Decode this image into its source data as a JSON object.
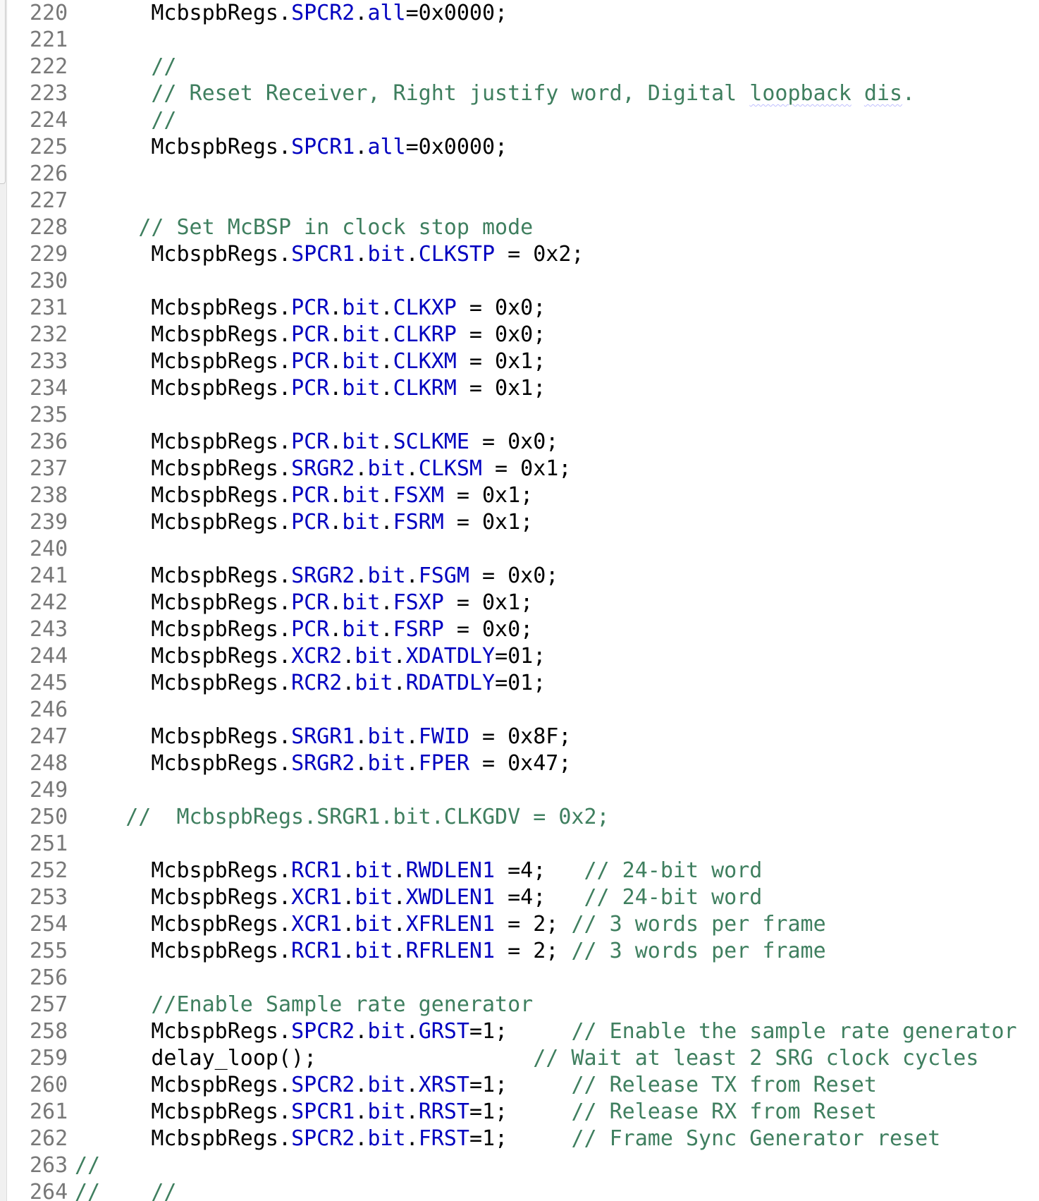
{
  "editor": {
    "lines": [
      {
        "num": "220",
        "tokens": [
          {
            "t": "      "
          },
          {
            "t": "McbspbRegs."
          },
          {
            "t": "SPCR2",
            "c": "field"
          },
          {
            "t": "."
          },
          {
            "t": "all",
            "c": "field"
          },
          {
            "t": "=0x0000;"
          }
        ]
      },
      {
        "num": "221",
        "tokens": []
      },
      {
        "num": "222",
        "tokens": [
          {
            "t": "      "
          },
          {
            "t": "//",
            "c": "comment"
          }
        ]
      },
      {
        "num": "223",
        "tokens": [
          {
            "t": "      "
          },
          {
            "t": "// Reset Receiver, Right justify word, Digital ",
            "c": "comment"
          },
          {
            "t": "loopback",
            "c": "spell"
          },
          {
            "t": " ",
            "c": "comment"
          },
          {
            "t": "dis",
            "c": "spell"
          },
          {
            "t": ".",
            "c": "comment"
          }
        ]
      },
      {
        "num": "224",
        "tokens": [
          {
            "t": "      "
          },
          {
            "t": "//",
            "c": "comment"
          }
        ]
      },
      {
        "num": "225",
        "tokens": [
          {
            "t": "      "
          },
          {
            "t": "McbspbRegs."
          },
          {
            "t": "SPCR1",
            "c": "field"
          },
          {
            "t": "."
          },
          {
            "t": "all",
            "c": "field"
          },
          {
            "t": "=0x0000;"
          }
        ]
      },
      {
        "num": "226",
        "tokens": []
      },
      {
        "num": "227",
        "tokens": []
      },
      {
        "num": "228",
        "tokens": [
          {
            "t": "     "
          },
          {
            "t": "// Set McBSP in clock stop mode",
            "c": "comment"
          }
        ]
      },
      {
        "num": "229",
        "tokens": [
          {
            "t": "      "
          },
          {
            "t": "McbspbRegs."
          },
          {
            "t": "SPCR1",
            "c": "field"
          },
          {
            "t": "."
          },
          {
            "t": "bit",
            "c": "field"
          },
          {
            "t": "."
          },
          {
            "t": "CLKSTP",
            "c": "field"
          },
          {
            "t": " = 0x2;"
          }
        ]
      },
      {
        "num": "230",
        "tokens": []
      },
      {
        "num": "231",
        "tokens": [
          {
            "t": "      "
          },
          {
            "t": "McbspbRegs."
          },
          {
            "t": "PCR",
            "c": "field"
          },
          {
            "t": "."
          },
          {
            "t": "bit",
            "c": "field"
          },
          {
            "t": "."
          },
          {
            "t": "CLKXP",
            "c": "field"
          },
          {
            "t": " = 0x0;"
          }
        ]
      },
      {
        "num": "232",
        "tokens": [
          {
            "t": "      "
          },
          {
            "t": "McbspbRegs."
          },
          {
            "t": "PCR",
            "c": "field"
          },
          {
            "t": "."
          },
          {
            "t": "bit",
            "c": "field"
          },
          {
            "t": "."
          },
          {
            "t": "CLKRP",
            "c": "field"
          },
          {
            "t": " = 0x0;"
          }
        ]
      },
      {
        "num": "233",
        "tokens": [
          {
            "t": "      "
          },
          {
            "t": "McbspbRegs."
          },
          {
            "t": "PCR",
            "c": "field"
          },
          {
            "t": "."
          },
          {
            "t": "bit",
            "c": "field"
          },
          {
            "t": "."
          },
          {
            "t": "CLKXM",
            "c": "field"
          },
          {
            "t": " = 0x1;"
          }
        ]
      },
      {
        "num": "234",
        "tokens": [
          {
            "t": "      "
          },
          {
            "t": "McbspbRegs."
          },
          {
            "t": "PCR",
            "c": "field"
          },
          {
            "t": "."
          },
          {
            "t": "bit",
            "c": "field"
          },
          {
            "t": "."
          },
          {
            "t": "CLKRM",
            "c": "field"
          },
          {
            "t": " = 0x1;"
          }
        ]
      },
      {
        "num": "235",
        "tokens": []
      },
      {
        "num": "236",
        "tokens": [
          {
            "t": "      "
          },
          {
            "t": "McbspbRegs."
          },
          {
            "t": "PCR",
            "c": "field"
          },
          {
            "t": "."
          },
          {
            "t": "bit",
            "c": "field"
          },
          {
            "t": "."
          },
          {
            "t": "SCLKME",
            "c": "field"
          },
          {
            "t": " = 0x0;"
          }
        ]
      },
      {
        "num": "237",
        "tokens": [
          {
            "t": "      "
          },
          {
            "t": "McbspbRegs."
          },
          {
            "t": "SRGR2",
            "c": "field"
          },
          {
            "t": "."
          },
          {
            "t": "bit",
            "c": "field"
          },
          {
            "t": "."
          },
          {
            "t": "CLKSM",
            "c": "field"
          },
          {
            "t": " = 0x1;"
          }
        ]
      },
      {
        "num": "238",
        "tokens": [
          {
            "t": "      "
          },
          {
            "t": "McbspbRegs."
          },
          {
            "t": "PCR",
            "c": "field"
          },
          {
            "t": "."
          },
          {
            "t": "bit",
            "c": "field"
          },
          {
            "t": "."
          },
          {
            "t": "FSXM",
            "c": "field"
          },
          {
            "t": " = 0x1;"
          }
        ]
      },
      {
        "num": "239",
        "tokens": [
          {
            "t": "      "
          },
          {
            "t": "McbspbRegs."
          },
          {
            "t": "PCR",
            "c": "field"
          },
          {
            "t": "."
          },
          {
            "t": "bit",
            "c": "field"
          },
          {
            "t": "."
          },
          {
            "t": "FSRM",
            "c": "field"
          },
          {
            "t": " = 0x1;"
          }
        ]
      },
      {
        "num": "240",
        "tokens": []
      },
      {
        "num": "241",
        "tokens": [
          {
            "t": "      "
          },
          {
            "t": "McbspbRegs."
          },
          {
            "t": "SRGR2",
            "c": "field"
          },
          {
            "t": "."
          },
          {
            "t": "bit",
            "c": "field"
          },
          {
            "t": "."
          },
          {
            "t": "FSGM",
            "c": "field"
          },
          {
            "t": " = 0x0;"
          }
        ]
      },
      {
        "num": "242",
        "tokens": [
          {
            "t": "      "
          },
          {
            "t": "McbspbRegs."
          },
          {
            "t": "PCR",
            "c": "field"
          },
          {
            "t": "."
          },
          {
            "t": "bit",
            "c": "field"
          },
          {
            "t": "."
          },
          {
            "t": "FSXP",
            "c": "field"
          },
          {
            "t": " = 0x1;"
          }
        ]
      },
      {
        "num": "243",
        "tokens": [
          {
            "t": "      "
          },
          {
            "t": "McbspbRegs."
          },
          {
            "t": "PCR",
            "c": "field"
          },
          {
            "t": "."
          },
          {
            "t": "bit",
            "c": "field"
          },
          {
            "t": "."
          },
          {
            "t": "FSRP",
            "c": "field"
          },
          {
            "t": " = 0x0;"
          }
        ]
      },
      {
        "num": "244",
        "tokens": [
          {
            "t": "      "
          },
          {
            "t": "McbspbRegs."
          },
          {
            "t": "XCR2",
            "c": "field"
          },
          {
            "t": "."
          },
          {
            "t": "bit",
            "c": "field"
          },
          {
            "t": "."
          },
          {
            "t": "XDATDLY",
            "c": "field"
          },
          {
            "t": "=01;"
          }
        ]
      },
      {
        "num": "245",
        "tokens": [
          {
            "t": "      "
          },
          {
            "t": "McbspbRegs."
          },
          {
            "t": "RCR2",
            "c": "field"
          },
          {
            "t": "."
          },
          {
            "t": "bit",
            "c": "field"
          },
          {
            "t": "."
          },
          {
            "t": "RDATDLY",
            "c": "field"
          },
          {
            "t": "=01;"
          }
        ]
      },
      {
        "num": "246",
        "tokens": []
      },
      {
        "num": "247",
        "tokens": [
          {
            "t": "      "
          },
          {
            "t": "McbspbRegs."
          },
          {
            "t": "SRGR1",
            "c": "field"
          },
          {
            "t": "."
          },
          {
            "t": "bit",
            "c": "field"
          },
          {
            "t": "."
          },
          {
            "t": "FWID",
            "c": "field"
          },
          {
            "t": " = 0x8F;"
          }
        ]
      },
      {
        "num": "248",
        "tokens": [
          {
            "t": "      "
          },
          {
            "t": "McbspbRegs."
          },
          {
            "t": "SRGR2",
            "c": "field"
          },
          {
            "t": "."
          },
          {
            "t": "bit",
            "c": "field"
          },
          {
            "t": "."
          },
          {
            "t": "FPER",
            "c": "field"
          },
          {
            "t": " = 0x47;"
          }
        ]
      },
      {
        "num": "249",
        "tokens": []
      },
      {
        "num": "250",
        "tokens": [
          {
            "t": "    "
          },
          {
            "t": "//  McbspbRegs.SRGR1.bit.CLKGDV = 0x2;",
            "c": "comment"
          }
        ]
      },
      {
        "num": "251",
        "tokens": []
      },
      {
        "num": "252",
        "tokens": [
          {
            "t": "      "
          },
          {
            "t": "McbspbRegs."
          },
          {
            "t": "RCR1",
            "c": "field"
          },
          {
            "t": "."
          },
          {
            "t": "bit",
            "c": "field"
          },
          {
            "t": "."
          },
          {
            "t": "RWDLEN1",
            "c": "field"
          },
          {
            "t": " =4;   "
          },
          {
            "t": "// 24-bit word",
            "c": "comment"
          }
        ]
      },
      {
        "num": "253",
        "tokens": [
          {
            "t": "      "
          },
          {
            "t": "McbspbRegs."
          },
          {
            "t": "XCR1",
            "c": "field"
          },
          {
            "t": "."
          },
          {
            "t": "bit",
            "c": "field"
          },
          {
            "t": "."
          },
          {
            "t": "XWDLEN1",
            "c": "field"
          },
          {
            "t": " =4;   "
          },
          {
            "t": "// 24-bit word",
            "c": "comment"
          }
        ]
      },
      {
        "num": "254",
        "tokens": [
          {
            "t": "      "
          },
          {
            "t": "McbspbRegs."
          },
          {
            "t": "XCR1",
            "c": "field"
          },
          {
            "t": "."
          },
          {
            "t": "bit",
            "c": "field"
          },
          {
            "t": "."
          },
          {
            "t": "XFRLEN1",
            "c": "field"
          },
          {
            "t": " = 2; "
          },
          {
            "t": "// 3 words per frame",
            "c": "comment"
          }
        ]
      },
      {
        "num": "255",
        "tokens": [
          {
            "t": "      "
          },
          {
            "t": "McbspbRegs."
          },
          {
            "t": "RCR1",
            "c": "field"
          },
          {
            "t": "."
          },
          {
            "t": "bit",
            "c": "field"
          },
          {
            "t": "."
          },
          {
            "t": "RFRLEN1",
            "c": "field"
          },
          {
            "t": " = 2; "
          },
          {
            "t": "// 3 words per frame",
            "c": "comment"
          }
        ]
      },
      {
        "num": "256",
        "tokens": []
      },
      {
        "num": "257",
        "tokens": [
          {
            "t": "      "
          },
          {
            "t": "//Enable Sample rate generator",
            "c": "comment"
          }
        ]
      },
      {
        "num": "258",
        "tokens": [
          {
            "t": "      "
          },
          {
            "t": "McbspbRegs."
          },
          {
            "t": "SPCR2",
            "c": "field"
          },
          {
            "t": "."
          },
          {
            "t": "bit",
            "c": "field"
          },
          {
            "t": "."
          },
          {
            "t": "GRST",
            "c": "field"
          },
          {
            "t": "=1;     "
          },
          {
            "t": "// Enable the sample rate generator",
            "c": "comment"
          }
        ]
      },
      {
        "num": "259",
        "tokens": [
          {
            "t": "      "
          },
          {
            "t": "delay_loop();"
          },
          {
            "t": "                 "
          },
          {
            "t": "// Wait at least 2 SRG clock cycles",
            "c": "comment"
          }
        ]
      },
      {
        "num": "260",
        "tokens": [
          {
            "t": "      "
          },
          {
            "t": "McbspbRegs."
          },
          {
            "t": "SPCR2",
            "c": "field"
          },
          {
            "t": "."
          },
          {
            "t": "bit",
            "c": "field"
          },
          {
            "t": "."
          },
          {
            "t": "XRST",
            "c": "field"
          },
          {
            "t": "=1;     "
          },
          {
            "t": "// Release TX from Reset",
            "c": "comment"
          }
        ]
      },
      {
        "num": "261",
        "tokens": [
          {
            "t": "      "
          },
          {
            "t": "McbspbRegs."
          },
          {
            "t": "SPCR1",
            "c": "field"
          },
          {
            "t": "."
          },
          {
            "t": "bit",
            "c": "field"
          },
          {
            "t": "."
          },
          {
            "t": "RRST",
            "c": "field"
          },
          {
            "t": "=1;     "
          },
          {
            "t": "// Release RX from Reset",
            "c": "comment"
          }
        ]
      },
      {
        "num": "262",
        "tokens": [
          {
            "t": "      "
          },
          {
            "t": "McbspbRegs."
          },
          {
            "t": "SPCR2",
            "c": "field"
          },
          {
            "t": "."
          },
          {
            "t": "bit",
            "c": "field"
          },
          {
            "t": "."
          },
          {
            "t": "FRST",
            "c": "field"
          },
          {
            "t": "=1;     "
          },
          {
            "t": "// Frame Sync Generator reset",
            "c": "comment"
          }
        ]
      },
      {
        "num": "263",
        "tokens": [
          {
            "t": "//",
            "c": "comment"
          }
        ]
      },
      {
        "num": "264",
        "tokens": [
          {
            "t": "//    //",
            "c": "comment"
          }
        ]
      }
    ]
  }
}
